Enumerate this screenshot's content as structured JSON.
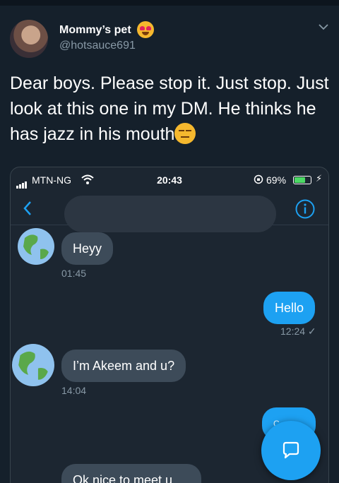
{
  "tweet": {
    "display_name": "Mommy’s pet",
    "handle": "@hotsauce691",
    "text": "Dear boys. Please stop it. Just stop. Just look at this one in my DM. He thinks he has jazz in his mouth"
  },
  "phone": {
    "status": {
      "carrier": "MTN-NG",
      "time": "20:43",
      "battery": "69%",
      "battery_level": 0.69
    }
  },
  "messages": [
    {
      "dir": "in",
      "text": "Heyy",
      "time": "01:45"
    },
    {
      "dir": "out",
      "text": "Hello",
      "time": "12:24 ✓"
    },
    {
      "dir": "in",
      "text": "I’m Akeem and u?",
      "time": "14:04"
    },
    {
      "dir": "out",
      "text": "C..."
    },
    {
      "dir": "in",
      "text": "Ok nice to meet u"
    }
  ],
  "colors": {
    "background": "#15202b",
    "accent": "#1da1f2",
    "incoming_bubble": "#3d4b59"
  },
  "icons": {
    "compose": "compose-message-icon",
    "back": "back-chevron-icon",
    "info": "info-icon"
  }
}
